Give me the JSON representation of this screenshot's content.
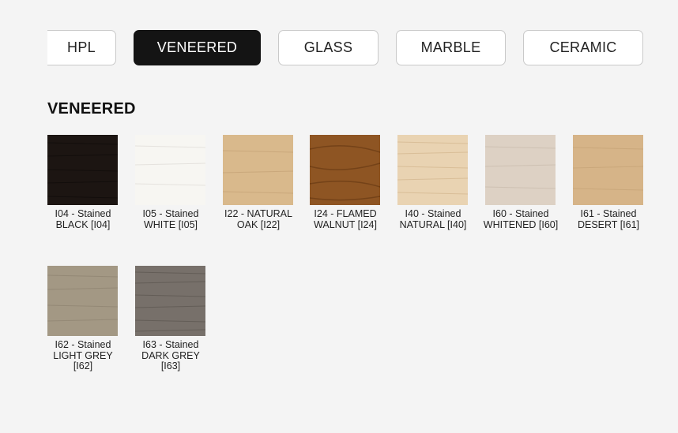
{
  "tabs": [
    {
      "label": "HPL",
      "active": false
    },
    {
      "label": "VENEERED",
      "active": true
    },
    {
      "label": "GLASS",
      "active": false
    },
    {
      "label": "MARBLE",
      "active": false
    },
    {
      "label": "CERAMIC",
      "active": false
    }
  ],
  "section": {
    "title": "VENEERED"
  },
  "swatches": [
    {
      "label": "I04 - Stained BLACK [I04]",
      "color": "#1c1512"
    },
    {
      "label": "I05 - Stained WHITE [I05]",
      "color": "#f7f6f2"
    },
    {
      "label": "I22 - NATURAL OAK [I22]",
      "color": "#d9b98c"
    },
    {
      "label": "I24 - FLAMED WALNUT [I24]",
      "color": "#8e5523"
    },
    {
      "label": "I40 - Stained NATURAL [I40]",
      "color": "#e9d3b2"
    },
    {
      "label": "I60 - Stained WHITENED [I60]",
      "color": "#ddd1c4"
    },
    {
      "label": "I61 - Stained DESERT [I61]",
      "color": "#d6b488"
    },
    {
      "label": "I62 - Stained LIGHT GREY [I62]",
      "color": "#a39884"
    },
    {
      "label": "I63 - Stained DARK GREY [I63]",
      "color": "#77706a"
    }
  ]
}
